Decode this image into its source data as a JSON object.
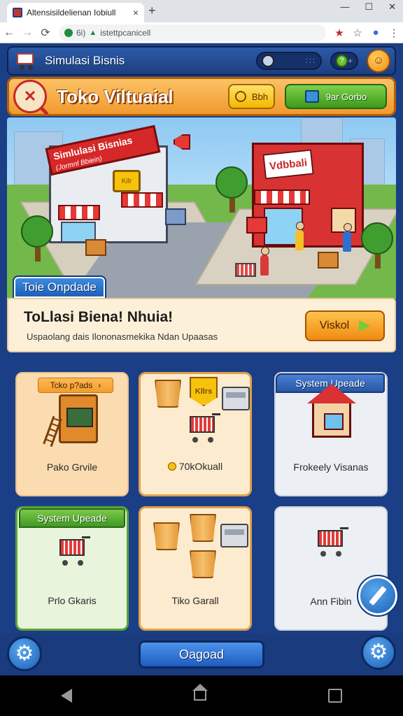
{
  "browser": {
    "tab_title": "Altensisildelienan Iobiull",
    "tab_close": "×",
    "new_tab": "+",
    "window_controls": [
      "—",
      "☐",
      "✕"
    ],
    "url_prefix": "6i)",
    "url": "istettpcanicell",
    "nav": {
      "back": "←",
      "forward": "→",
      "reload": "⟳"
    },
    "toolbar_icons": [
      "star-icon",
      "bookmark-star-icon",
      "extension-icon",
      "menu-icon"
    ]
  },
  "header": {
    "title": "Simulasi Bisnis",
    "search_dots": ":::",
    "coin_symbol": "?",
    "coin_add": "+"
  },
  "shop_bar": {
    "title": "Toko Viltuaial",
    "button_tool_label": "Bbh",
    "button_green_label": "9ar Gorbo"
  },
  "scene": {
    "sign_left_line1": "Simlulasi",
    "sign_left_line2": "Bisnias",
    "sign_left_line3": "(Jormnl Bbiein)",
    "sign_right": "Vdbbali",
    "plate_left": "Kilr"
  },
  "promo": {
    "tab_label": "Toie Onpdade",
    "title": "ToLlasi Biena! Nhuia!",
    "subtitle": "Uspaolang dais Ilononasmekika Ndan Upaasas",
    "button_label": "Viskol"
  },
  "cards": [
    {
      "ribbon": "Tcko p?ads",
      "ribbon_arrow": "›",
      "label": "Pako Grvile"
    },
    {
      "crest": "Kllrs",
      "label": "70kOkuall"
    },
    {
      "ribbon": "System Upeade",
      "label": "Frokeely Visanas"
    },
    {
      "ribbon": "System Upeade",
      "label": "Prlo Gkaris"
    },
    {
      "label": "Tiko Garall"
    },
    {
      "label": "Ann Fibin"
    }
  ],
  "bottom": {
    "load_button": "Oagoad"
  },
  "colors": {
    "frame_blue": "#1b3f86",
    "shop_orange": "#f19a2e",
    "accent_red": "#d62828",
    "accent_green": "#3c9a1c"
  }
}
